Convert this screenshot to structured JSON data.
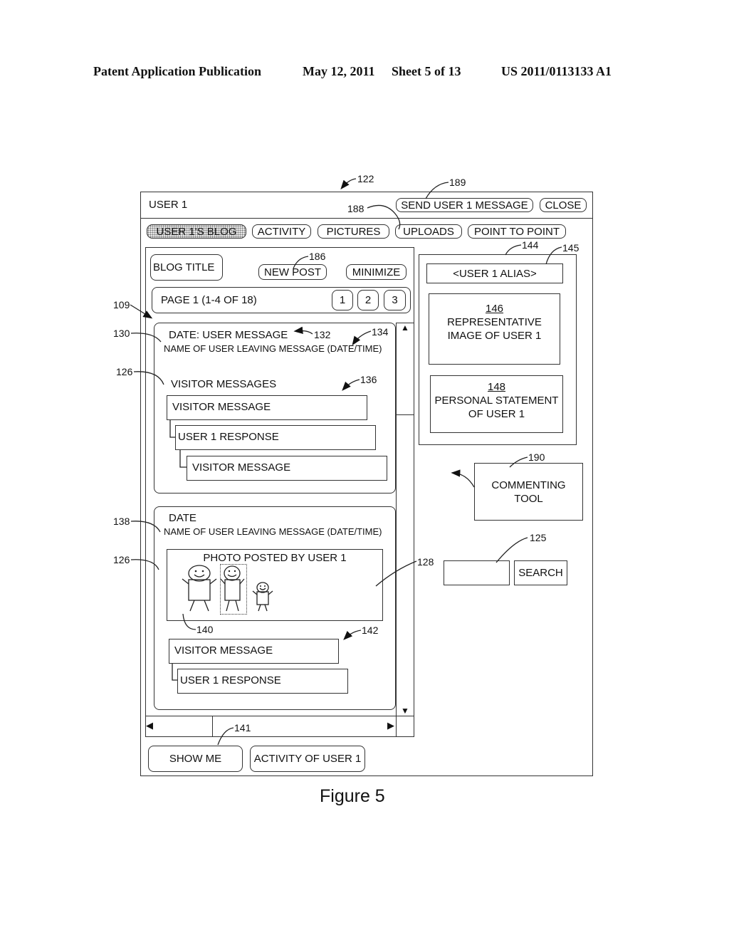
{
  "header": {
    "left": "Patent Application Publication",
    "date": "May 12, 2011",
    "sheet": "Sheet 5 of 13",
    "number": "US 2011/0113133 A1"
  },
  "window": {
    "title": "USER 1",
    "send_message_label": "SEND USER 1 MESSAGE",
    "close_label": "CLOSE"
  },
  "tabs": [
    {
      "label": "USER 1'S BLOG",
      "active": true
    },
    {
      "label": "ACTIVITY",
      "active": false
    },
    {
      "label": "PICTURES",
      "active": false
    },
    {
      "label": "UPLOADS",
      "active": false
    },
    {
      "label": "POINT TO POINT",
      "active": false
    }
  ],
  "blog": {
    "title_label": "BLOG TITLE",
    "new_post_label": "NEW POST",
    "minimize_label": "MINIMIZE",
    "page_label": "PAGE 1 (1-4 OF 18)",
    "pages": [
      "1",
      "2",
      "3"
    ],
    "post1": {
      "heading": "DATE: USER MESSAGE",
      "byline": "NAME OF USER LEAVING MESSAGE (DATE/TIME)",
      "section": "VISITOR MESSAGES",
      "thread": [
        "VISITOR MESSAGE",
        "USER 1 RESPONSE",
        "VISITOR MESSAGE"
      ]
    },
    "post2": {
      "heading": "DATE",
      "byline": "NAME OF USER LEAVING MESSAGE (DATE/TIME)",
      "photo_caption": "PHOTO POSTED BY USER 1",
      "thread": [
        "VISITOR MESSAGE",
        "USER 1 RESPONSE"
      ]
    }
  },
  "profile": {
    "alias": "<USER 1 ALIAS>",
    "image_ref": "146",
    "image_label_1": "REPRESENTATIVE",
    "image_label_2": "IMAGE OF USER 1",
    "statement_ref": "148",
    "statement_label_1": "PERSONAL STATEMENT",
    "statement_label_2": "OF USER 1"
  },
  "commenting_tool": {
    "line1": "COMMENTING",
    "line2": "TOOL"
  },
  "search": {
    "value": "",
    "button_label": "SEARCH"
  },
  "footer_buttons": {
    "show_me": "SHOW ME",
    "activity": "ACTIVITY OF USER 1"
  },
  "figure_caption": "Figure 5",
  "refs": {
    "r122": "122",
    "r189": "189",
    "r188": "188",
    "r186": "186",
    "r144": "144",
    "r145": "145",
    "r109": "109",
    "r130": "130",
    "r132": "132",
    "r134": "134",
    "r126a": "126",
    "r136": "136",
    "r138": "138",
    "r126b": "126",
    "r128": "128",
    "r140": "140",
    "r142": "142",
    "r141": "141",
    "r190": "190",
    "r125": "125"
  }
}
